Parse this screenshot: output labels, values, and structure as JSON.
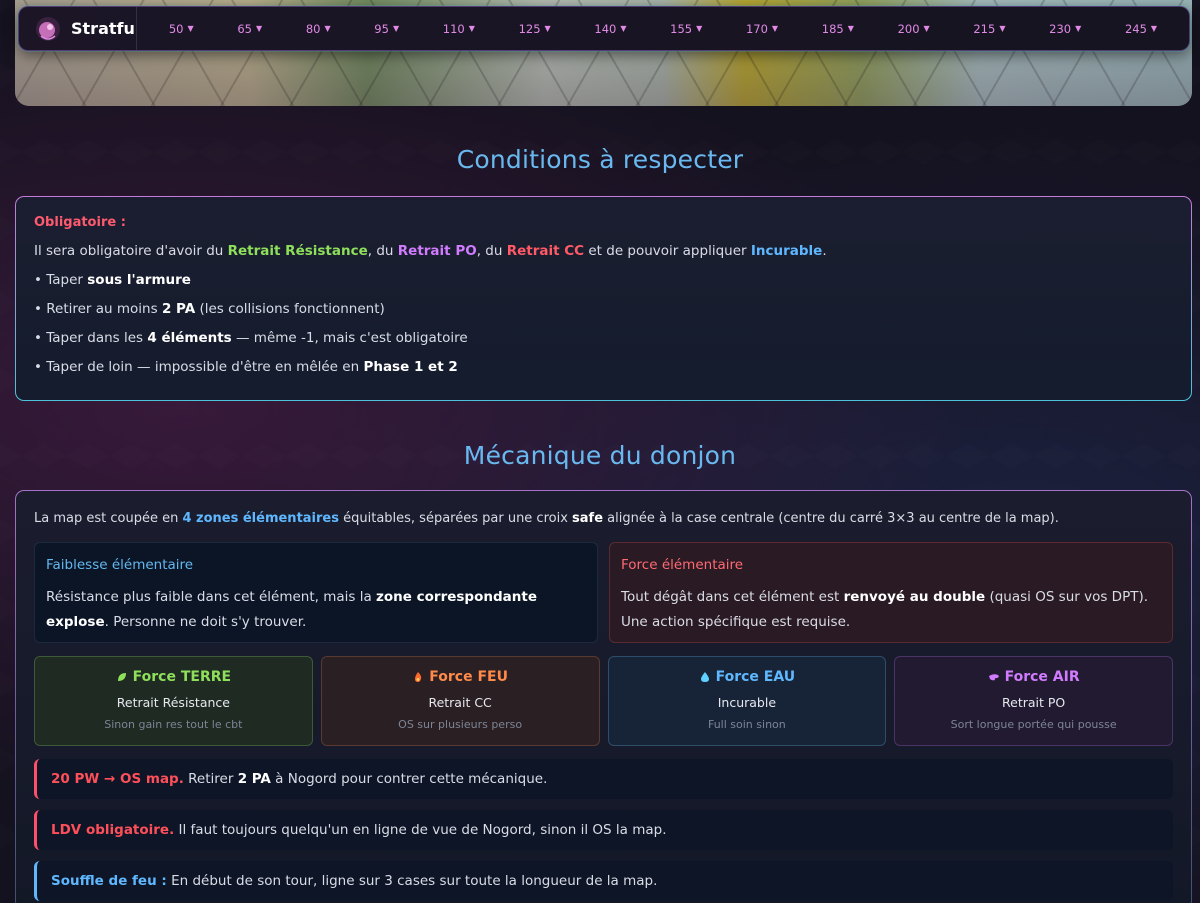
{
  "nav": {
    "brand": "Stratfu",
    "items": [
      "50",
      "65",
      "80",
      "95",
      "110",
      "125",
      "140",
      "155",
      "170",
      "185",
      "200",
      "215",
      "230",
      "245"
    ]
  },
  "conditions": {
    "title": "Conditions à respecter",
    "header": "Obligatoire :",
    "line1": {
      "p1": "Il sera obligatoire d'avoir du ",
      "k1": "Retrait Résistance",
      "p2": ", du ",
      "k2": "Retrait PO",
      "p3": ", du ",
      "k3": "Retrait CC",
      "p4": " et de pouvoir appliquer ",
      "k4": "Incurable",
      "p5": "."
    },
    "bullets": [
      {
        "a": "• Taper ",
        "b": "sous l'armure",
        "c": ""
      },
      {
        "a": "• Retirer au moins ",
        "b": "2 PA",
        "c": " (les collisions fonctionnent)"
      },
      {
        "a": "• Taper dans les ",
        "b": "4 éléments",
        "c": " — même -1, mais c'est obligatoire"
      },
      {
        "a": "• Taper de loin — impossible d'être en mêlée en ",
        "b": "Phase 1 et 2",
        "c": ""
      }
    ]
  },
  "mecanique": {
    "title": "Mécanique du donjon",
    "intro": {
      "p1": "La map est coupée en ",
      "k1": "4 zones élémentaires",
      "p2": " équitables, séparées par une croix ",
      "k2": "safe",
      "p3": " alignée à la case centrale (centre du carré 3×3 au centre de la map)."
    },
    "weakness": {
      "title": "Faiblesse élémentaire",
      "p1": "Résistance plus faible dans cet élément, mais la ",
      "k1": "zone correspondante explose",
      "p2": ". Personne ne doit s'y trouver."
    },
    "strength": {
      "title": "Force élémentaire",
      "p1": "Tout dégât dans cet élément est ",
      "k1": "renvoyé au double",
      "p2": " (quasi OS sur vos DPT). Une action spécifique est requise."
    },
    "forces": [
      {
        "title": "Force TERRE",
        "sub": "Retrait Résistance",
        "note": "Sinon gain res tout le cbt",
        "icon": "leaf-icon"
      },
      {
        "title": "Force FEU",
        "sub": "Retrait CC",
        "note": "OS sur plusieurs perso",
        "icon": "flame-icon"
      },
      {
        "title": "Force EAU",
        "sub": "Incurable",
        "note": "Full soin sinon",
        "icon": "droplet-icon"
      },
      {
        "title": "Force AIR",
        "sub": "Retrait PO",
        "note": "Sort longue portée qui pousse",
        "icon": "wind-icon"
      }
    ],
    "notes": [
      {
        "k": "20 PW → OS map.",
        "p1": " Retirer ",
        "k2": "2 PA",
        "p2": " à Nogord pour contrer cette mécanique."
      },
      {
        "k": "LDV obligatoire.",
        "p1": " Il faut toujours quelqu'un en ligne de vue de Nogord, sinon il OS la map."
      },
      {
        "k": "Souffle de feu :",
        "p1": " En début de son tour, ligne sur 3 cases sur toute la longueur de la map."
      }
    ]
  }
}
